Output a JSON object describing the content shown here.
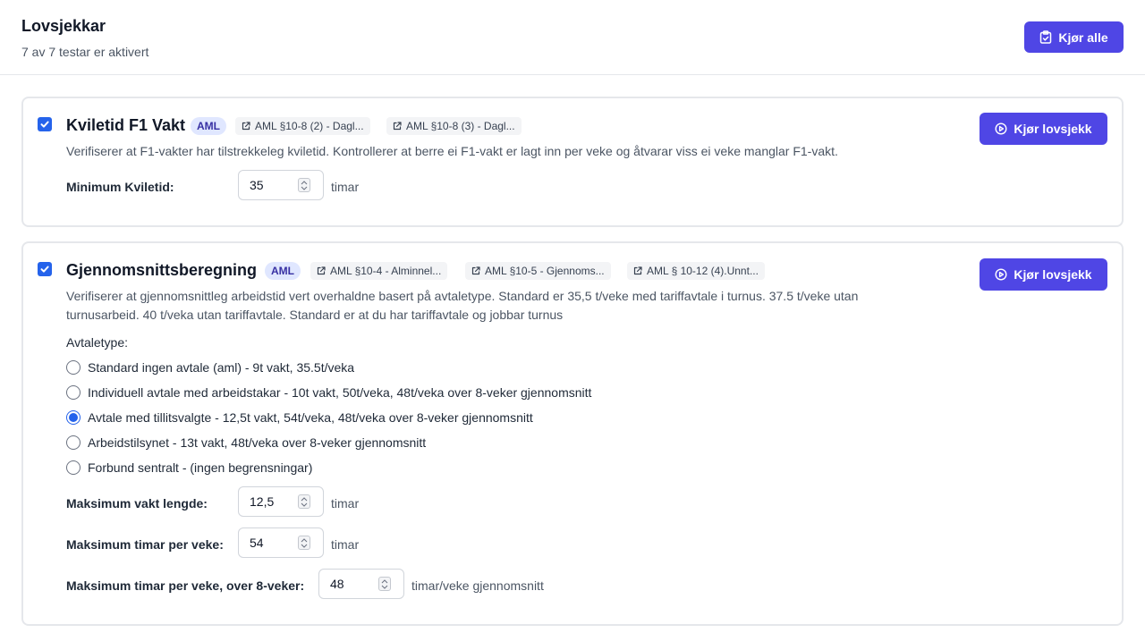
{
  "header": {
    "title": "Lovsjekkar",
    "subtitle": "7 av 7 testar er aktivert",
    "run_all_label": "Kjør alle"
  },
  "rules": [
    {
      "title": "Kviletid F1 Vakt",
      "badge": "AML",
      "enabled": true,
      "refs": [
        "AML §10-8 (2) - Dagl...",
        "AML §10-8 (3) - Dagl..."
      ],
      "description": "Verifiserer at F1-vakter har tilstrekkeleg kviletid. Kontrollerer at berre ei F1-vakt er lagt inn per veke og åtvarar viss ei veke manglar F1-vakt.",
      "run_label": "Kjør lovsjekk",
      "fields": [
        {
          "label": "Minimum Kviletid:",
          "value": "35",
          "unit": "timar"
        }
      ]
    },
    {
      "title": "Gjennomsnittsberegning",
      "badge": "AML",
      "enabled": true,
      "refs": [
        "AML §10-4 - Alminnel...",
        "AML §10-5 - Gjennoms...",
        "AML § 10-12 (4).Unnt..."
      ],
      "description_line1": "Verifiserer at gjennomsnittleg arbeidstid vert overhaldne basert på avtaletype. Standard er 35,5 t/veke med tariffavtale i turnus. 37.5 t/veke utan",
      "description_line2": "turnusarbeid. 40 t/veka utan tariffavtale. Standard er at du har tariffavtale og jobbar turnus",
      "run_label": "Kjør lovsjekk",
      "agreement_label": "Avtaletype:",
      "agreement_options": [
        "Standard ingen avtale (aml) - 9t vakt, 35.5t/veka",
        "Individuell avtale med arbeidstakar - 10t vakt, 50t/veka, 48t/veka over 8-veker gjennomsnitt",
        "Avtale med tillitsvalgte - 12,5t vakt, 54t/veka, 48t/veka over 8-veker gjennomsnitt",
        "Arbeidstilsynet - 13t vakt, 48t/veka over 8-veker gjennomsnitt",
        "Forbund sentralt - (ingen begrensningar)"
      ],
      "selected_option": "Avtale med tillitsvalgte - 12,5t vakt, 54t/veka, 48t/veka over 8-veker gjennomsnitt",
      "fields": [
        {
          "label": "Maksimum vakt lengde:",
          "value": "12,5",
          "unit": "timar"
        },
        {
          "label": "Maksimum timar per veke:",
          "value": "54",
          "unit": "timar"
        },
        {
          "label": "Maksimum timar per veke, over 8-veker:",
          "value": "48",
          "unit": "timar/veke gjennomsnitt"
        }
      ]
    }
  ],
  "colors": {
    "accent": "#4f46e5",
    "checkbox": "#2563eb",
    "badge_bg": "#e0e7ff",
    "badge_text": "#3730a3"
  }
}
